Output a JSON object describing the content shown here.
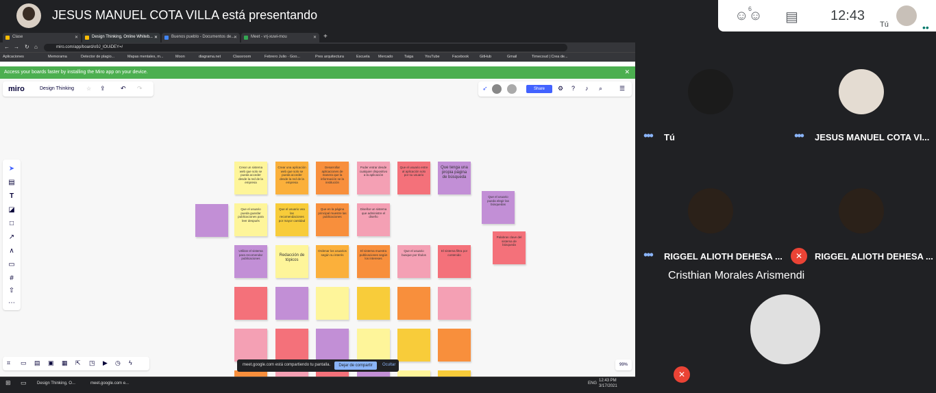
{
  "meet": {
    "presenter_title": "JESUS MANUEL COTA VILLA está presentando",
    "participant_count": "6",
    "time": "12:43",
    "self_label": "Tú"
  },
  "browser": {
    "tabs": [
      {
        "label": "Clase"
      },
      {
        "label": "Design Thinking, Online Whiteb..."
      },
      {
        "label": "Buenos pueblo - Documentos de..."
      },
      {
        "label": "Meet - vrj-xuwi-mou"
      }
    ],
    "url": "miro.com/app/board/o9J_lOUiDEY=/",
    "bookmarks": [
      "Aplicaciones",
      "Memorama",
      "Detector de plagio...",
      "Mapas mentales, m...",
      "Moon",
      "diagrama.net",
      "Classroom",
      "Febrero Julio · Goo...",
      "Pres arquitectura",
      "Escuela",
      "Mercado",
      "Taiga",
      "YouTube",
      "Facebook",
      "GitHub",
      "Gmail",
      "Timecoud | Crea de..."
    ],
    "banner": "Access your boards faster by installing the Miro app on your device."
  },
  "miro": {
    "logo": "miro",
    "board_name": "Design Thinking",
    "share": "Share",
    "zoom": "99%",
    "notes": [
      {
        "text": "Crear un sistema web que solo se pueda acceder desde la red de la empresa",
        "color": "yl"
      },
      {
        "text": "Crear una aplicación web que solo se pueda acceder desde la red de la empresa",
        "color": "or"
      },
      {
        "text": "Desarrollar aplicaciones de manera que la información se la institución",
        "color": "dor"
      },
      {
        "text": "Poder entrar desde cualquier dispositivo a la aplicación",
        "color": "pk"
      },
      {
        "text": "Que el usuario entre al aplicación solo por su usuario",
        "color": "rd"
      },
      {
        "text": "Que tenga una propia página de búsqueda",
        "color": "pu"
      },
      {
        "text": "",
        "color": "pu"
      },
      {
        "text": "Que el usuario pueda guardar publicaciones para leer después",
        "color": "yl"
      },
      {
        "text": "Que el usuario vea las recomendaciones por mayor cantidad",
        "color": "gd"
      },
      {
        "text": "Que en la página principal muestre las publicaciones",
        "color": "dor"
      },
      {
        "text": "Diseñar un sistema que administre el diseño",
        "color": "pk"
      },
      {
        "text": "Que el usuario pueda elegir las búsquedas",
        "color": "pu"
      },
      {
        "text": "Utilizar el sistema para recomendar publicaciones",
        "color": "pu"
      },
      {
        "text": "Redacción de tópicos",
        "color": "yl"
      },
      {
        "text": "Ordenar los usuarios según su interés",
        "color": "or"
      },
      {
        "text": "El sistema muestra publicaciones según los intereses",
        "color": "dor"
      },
      {
        "text": "Que el usuario busque por títulos",
        "color": "pk"
      },
      {
        "text": "El sistema filtra por contenido",
        "color": "rd"
      },
      {
        "text": "Palabras clave del sistema de búsqueda",
        "color": "rd"
      }
    ]
  },
  "sharing": {
    "text": "meet.google.com está compartiendo tu pantalla.",
    "stop": "Dejar de compartir",
    "hide": "Ocultar"
  },
  "taskbar": {
    "items": [
      "Design Thinking, O...",
      "meet.google.com e..."
    ],
    "time": "12:43 PM",
    "date": "3/17/2021",
    "lang": "ENG"
  },
  "participants": [
    {
      "name": "Tú"
    },
    {
      "name": "JESUS MANUEL COTA VI..."
    },
    {
      "name": "RIGGEL ALIOTH DEHESA ..."
    },
    {
      "name": "RIGGEL ALIOTH DEHESA ..."
    },
    {
      "name": "Cristhian Morales Arismendi"
    }
  ]
}
